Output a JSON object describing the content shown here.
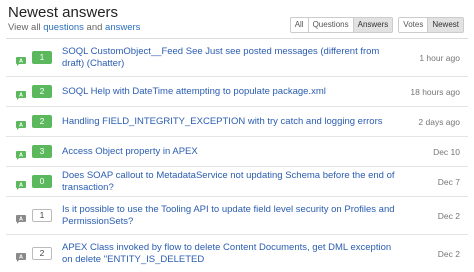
{
  "header": {
    "title": "Newest answers",
    "view_all_prefix": "View all",
    "questions_link": "questions",
    "and_text": "and",
    "answers_link": "answers"
  },
  "filters": {
    "group1": [
      "All",
      "Questions",
      "Answers"
    ],
    "group1_active": "Answers",
    "group2": [
      "Votes",
      "Newest"
    ],
    "group2_active": "Newest"
  },
  "colors": {
    "accepted": "#5cb85c",
    "link": "#2a5db0"
  },
  "items": [
    {
      "count": "1",
      "accepted": true,
      "title": "SOQL CustomObject__Feed See Just see posted messages (different from draft) (Chatter)",
      "time": "1 hour ago"
    },
    {
      "count": "2",
      "accepted": true,
      "title": "SOQL Help with DateTime attempting to populate package.xml",
      "time": "18 hours ago"
    },
    {
      "count": "2",
      "accepted": true,
      "title": "Handling FIELD_INTEGRITY_EXCEPTION with try catch and logging errors",
      "time": "2 days ago"
    },
    {
      "count": "3",
      "accepted": true,
      "title": "Access Object property in APEX",
      "time": "Dec 10"
    },
    {
      "count": "0",
      "accepted": true,
      "title": "Does SOAP callout to MetadataService not updating Schema before the end of transaction?",
      "time": "Dec 7"
    },
    {
      "count": "1",
      "accepted": false,
      "title": "Is it possible to use the Tooling API to update field level security on Profiles and PermissionSets?",
      "time": "Dec 2"
    },
    {
      "count": "2",
      "accepted": false,
      "title": "APEX Class invoked by flow to delete Content Documents, get DML exception on delete \"ENTITY_IS_DELETED",
      "time": "Dec 2"
    }
  ]
}
